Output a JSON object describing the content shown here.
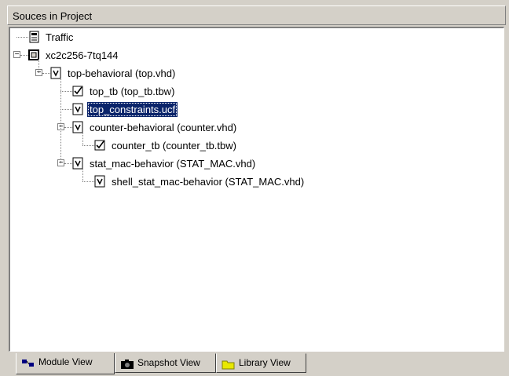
{
  "panel": {
    "title": "Souces in Project"
  },
  "tree": [
    {
      "label": "Traffic",
      "icon": "project-icon",
      "level": 0,
      "expander": "none",
      "selected": false
    },
    {
      "label": "xc2c256-7tq144",
      "icon": "device-icon",
      "level": 0,
      "expander": "minus",
      "selected": false
    },
    {
      "label": "top-behavioral (top.vhd)",
      "icon": "vhdl-file-icon",
      "level": 1,
      "expander": "minus",
      "selected": false
    },
    {
      "label": "top_tb (top_tb.tbw)",
      "icon": "testbench-icon",
      "level": 2,
      "expander": "none",
      "selected": false
    },
    {
      "label": "top_constraints.ucf",
      "icon": "constraints-file-icon",
      "level": 2,
      "expander": "none",
      "selected": true
    },
    {
      "label": "counter-behavioral (counter.vhd)",
      "icon": "vhdl-file-icon",
      "level": 2,
      "expander": "minus",
      "selected": false
    },
    {
      "label": "counter_tb (counter_tb.tbw)",
      "icon": "testbench-icon",
      "level": 3,
      "expander": "none",
      "selected": false
    },
    {
      "label": "stat_mac-behavior (STAT_MAC.vhd)",
      "icon": "vhdl-file-icon",
      "level": 2,
      "expander": "minus",
      "selected": false
    },
    {
      "label": "shell_stat_mac-behavior (STAT_MAC.vhd)",
      "icon": "vhdl-file-icon",
      "level": 3,
      "expander": "none",
      "selected": false
    }
  ],
  "tabs": [
    {
      "label": "Module View",
      "icon": "module-view-icon",
      "active": true
    },
    {
      "label": "Snapshot View",
      "icon": "camera-icon",
      "active": false
    },
    {
      "label": "Library View",
      "icon": "library-icon",
      "active": false
    }
  ],
  "colors": {
    "selection": "#0a246a",
    "panel_bg": "#d4d0c8"
  }
}
